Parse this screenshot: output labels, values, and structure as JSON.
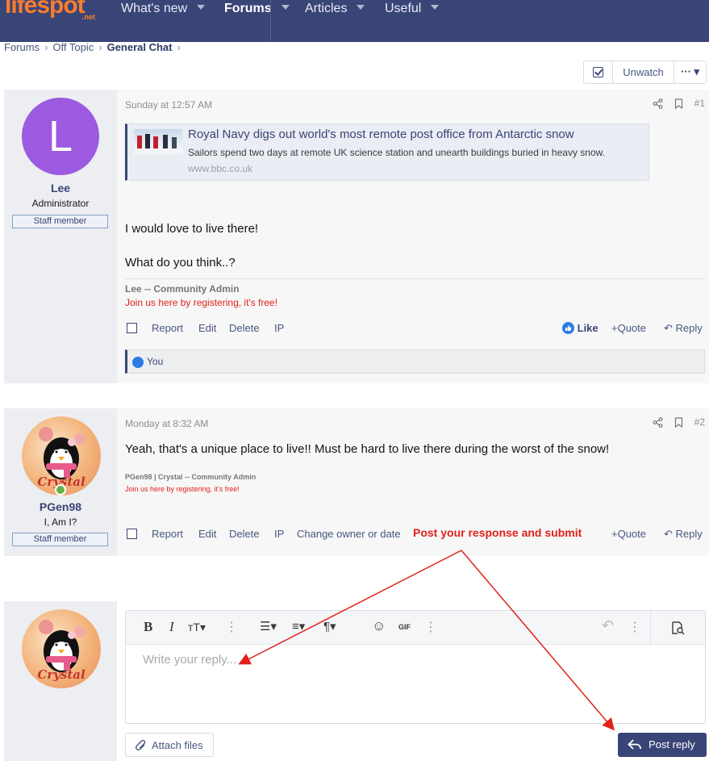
{
  "nav": {
    "logo": "lifespot",
    "logo_sub": ".net",
    "tabs": [
      {
        "label": "What's new"
      },
      {
        "label": "Forums"
      },
      {
        "label": "Articles"
      },
      {
        "label": "Useful"
      }
    ]
  },
  "breadcrumb": {
    "items": [
      "Forums",
      "Off Topic",
      "General Chat"
    ]
  },
  "watch": {
    "unwatch_label": "Unwatch",
    "more_label": "··· ▾"
  },
  "posts": [
    {
      "author": "Lee",
      "avatar_letter": "L",
      "title": "Administrator",
      "badge": "Staff member",
      "date": "Sunday at 12:57 AM",
      "number": "#1",
      "unfurl": {
        "title": "Royal Navy digs out world's most remote post office from Antarctic snow",
        "desc": "Sailors spend two days at remote UK science station and unearth buildings buried in heavy snow.",
        "host": "www.bbc.co.uk"
      },
      "body_lines": [
        "I would love to live there!",
        "What do you think..?"
      ],
      "signature_name": "Lee -- Community Admin",
      "signature_link": "Join us here by registering, it's free!",
      "actions": [
        "Report",
        "Edit",
        "Delete",
        "IP"
      ],
      "like_label": "Like",
      "quote_label": "Quote",
      "reply_label": "Reply",
      "reaction_text": "You"
    },
    {
      "author": "PGen98",
      "title": "I, Am I?",
      "badge": "Staff member",
      "date": "Monday at 8:32 AM",
      "number": "#2",
      "body_lines": [
        "Yeah, that's a unique place to live!! Must be hard to live there during the worst of the snow!"
      ],
      "signature_name": "PGen98 | Crystal -- Community Admin",
      "signature_link": "Join us here by registering, it's free!",
      "actions": [
        "Report",
        "Edit",
        "Delete",
        "IP",
        "Change owner or date"
      ],
      "quote_label": "Quote",
      "reply_label": "Reply"
    }
  ],
  "editor": {
    "placeholder": "Write your reply...",
    "attach_label": "Attach files",
    "post_label": "Post reply"
  },
  "annotation": {
    "text": "Post your response and submit",
    "color": "#e0211b"
  },
  "colors": {
    "nav_bg": "#3a4577",
    "logo": "#f97d2e",
    "link": "#47577f",
    "signature_link": "#e0211b",
    "like": "#2c7be5"
  }
}
